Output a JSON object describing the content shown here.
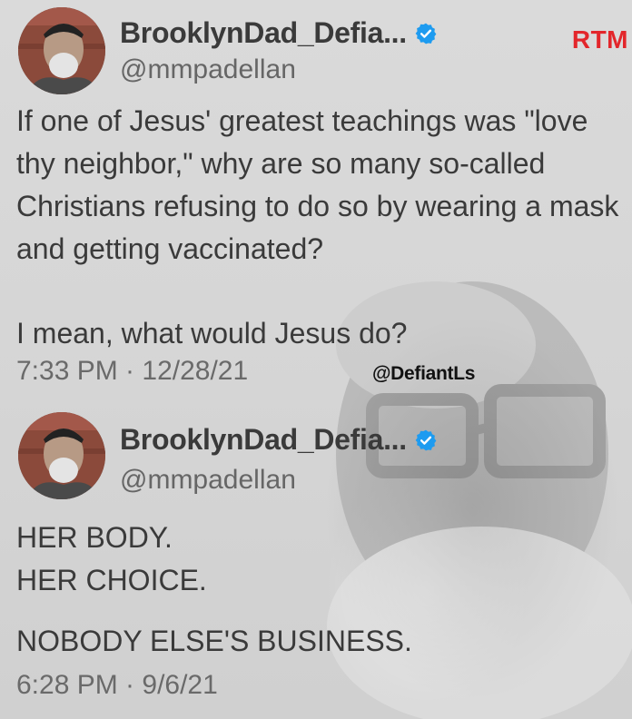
{
  "brand": "RTM",
  "watermark": "@DefiantLs",
  "tweets": [
    {
      "display_name": "BrooklynDad_Defia...",
      "handle": "@mmpadellan",
      "paragraphs": [
        "If one of Jesus' greatest teachings was \"love thy neighbor,\" why are so many so-called Christians refusing to do so by wearing a mask and getting vaccinated?",
        "I mean, what would Jesus do?"
      ],
      "timestamp": "7:33 PM · 12/28/21"
    },
    {
      "display_name": "BrooklynDad_Defia...",
      "handle": "@mmpadellan",
      "lines": [
        "HER BODY.",
        "HER CHOICE.",
        "NOBODY ELSE'S BUSINESS."
      ],
      "timestamp": "6:28 PM · 9/6/21"
    }
  ],
  "icons": {
    "verified": "verified-badge-icon",
    "avatar": "avatar-photo"
  },
  "colors": {
    "brand": "#e3262b",
    "verified": "#1d9bf0",
    "text": "#3a3a3a",
    "meta": "#6a6a6a"
  }
}
